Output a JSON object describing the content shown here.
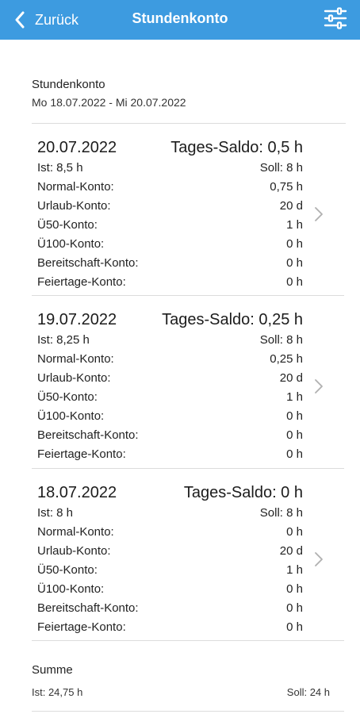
{
  "header": {
    "back_label": "Zurück",
    "title": "Stundenkonto",
    "filter_icon": "filter-sliders-icon",
    "color": "#3d9be0"
  },
  "period": {
    "title": "Stundenkonto",
    "range": "Mo 18.07.2022 - Mi 20.07.2022"
  },
  "days": [
    {
      "date": "20.07.2022",
      "saldo": "Tages-Saldo: 0,5 h",
      "ist": "Ist: 8,5 h",
      "soll": "Soll: 8 h",
      "accounts": [
        {
          "label": "Normal-Konto:",
          "value": "0,75 h"
        },
        {
          "label": "Urlaub-Konto:",
          "value": "20 d"
        },
        {
          "label": "Ü50-Konto:",
          "value": "1 h"
        },
        {
          "label": "Ü100-Konto:",
          "value": "0 h"
        },
        {
          "label": "Bereitschaft-Konto:",
          "value": "0 h"
        },
        {
          "label": "Feiertage-Konto:",
          "value": "0 h"
        }
      ]
    },
    {
      "date": "19.07.2022",
      "saldo": "Tages-Saldo: 0,25 h",
      "ist": "Ist: 8,25 h",
      "soll": "Soll: 8 h",
      "accounts": [
        {
          "label": "Normal-Konto:",
          "value": "0,25 h"
        },
        {
          "label": "Urlaub-Konto:",
          "value": "20 d"
        },
        {
          "label": "Ü50-Konto:",
          "value": "1 h"
        },
        {
          "label": "Ü100-Konto:",
          "value": "0 h"
        },
        {
          "label": "Bereitschaft-Konto:",
          "value": "0 h"
        },
        {
          "label": "Feiertage-Konto:",
          "value": "0 h"
        }
      ]
    },
    {
      "date": "18.07.2022",
      "saldo": "Tages-Saldo: 0 h",
      "ist": "Ist: 8 h",
      "soll": "Soll: 8 h",
      "accounts": [
        {
          "label": "Normal-Konto:",
          "value": "0 h"
        },
        {
          "label": "Urlaub-Konto:",
          "value": "20 d"
        },
        {
          "label": "Ü50-Konto:",
          "value": "1 h"
        },
        {
          "label": "Ü100-Konto:",
          "value": "0 h"
        },
        {
          "label": "Bereitschaft-Konto:",
          "value": "0 h"
        },
        {
          "label": "Feiertage-Konto:",
          "value": "0 h"
        }
      ]
    }
  ],
  "summary": {
    "title": "Summe",
    "ist": "Ist: 24,75 h",
    "soll": "Soll: 24 h"
  }
}
